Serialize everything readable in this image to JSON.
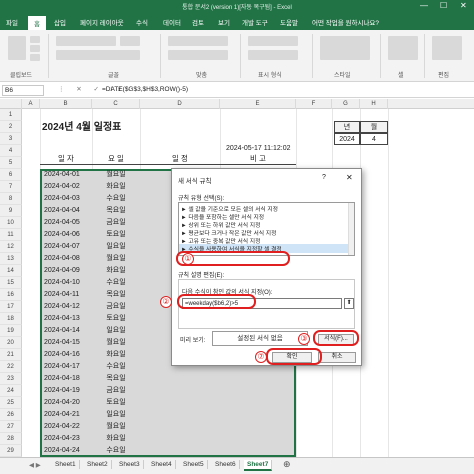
{
  "titlebar": {
    "title": "통합 문서2 (version 1)[자동 복구됨] - Excel",
    "min": "—",
    "max": "☐",
    "close": "✕"
  },
  "ribbon_tabs": [
    "파일",
    "홈",
    "삽입",
    "페이지 레이아웃",
    "수식",
    "데이터",
    "검토",
    "보기",
    "개발 도구",
    "도움말",
    "어떤 작업을 원하시나요?"
  ],
  "ribbon_groups": [
    "클립보드",
    "글꼴",
    "맞춤",
    "표시 형식",
    "스타일",
    "셀",
    "편집"
  ],
  "formula_bar": {
    "namebox": "B6",
    "icons": "⋮ ✕ ✓ fx",
    "formula": "=DATE($G$3,$H$3,ROW()-5)"
  },
  "columns": [
    "A",
    "B",
    "C",
    "D",
    "E",
    "F",
    "G",
    "H"
  ],
  "rows": [
    "1",
    "2",
    "3",
    "4",
    "5",
    "6",
    "7",
    "8",
    "9",
    "10",
    "11",
    "12",
    "13",
    "14",
    "15",
    "16",
    "17",
    "18",
    "19",
    "20",
    "21",
    "22",
    "23",
    "24",
    "25",
    "26",
    "27",
    "28",
    "29"
  ],
  "sheet": {
    "title": "2024년 4월 일정표",
    "timestamp": "2024-05-17 11:12:02",
    "header_year": "년",
    "header_month": "월",
    "year": "2024",
    "month": "4",
    "col_headers": {
      "date": "일 자",
      "weekday": "요 일",
      "schedule": "일 정",
      "note": "비 고"
    },
    "dates": [
      "2024-04-01",
      "2024-04-02",
      "2024-04-03",
      "2024-04-04",
      "2024-04-05",
      "2024-04-06",
      "2024-04-07",
      "2024-04-08",
      "2024-04-09",
      "2024-04-10",
      "2024-04-11",
      "2024-04-12",
      "2024-04-13",
      "2024-04-14",
      "2024-04-15",
      "2024-04-16",
      "2024-04-17",
      "2024-04-18",
      "2024-04-19",
      "2024-04-20",
      "2024-04-21",
      "2024-04-22",
      "2024-04-23",
      "2024-04-24"
    ],
    "weekdays": [
      "월요일",
      "화요일",
      "수요일",
      "목요일",
      "금요일",
      "토요일",
      "일요일",
      "월요일",
      "화요일",
      "수요일",
      "목요일",
      "금요일",
      "토요일",
      "일요일",
      "월요일",
      "화요일",
      "수요일",
      "목요일",
      "금요일",
      "토요일",
      "일요일",
      "월요일",
      "화요일",
      "수요일"
    ]
  },
  "sheet_tabs": [
    "Sheet1",
    "Sheet2",
    "Sheet3",
    "Sheet4",
    "Sheet5",
    "Sheet6",
    "Sheet7"
  ],
  "active_sheet": "Sheet7",
  "dialog": {
    "title": "새 서식 규칙",
    "help": "?",
    "close": "✕",
    "rule_type_label": "규칙 유형 선택(S):",
    "rule_types": [
      "► 셀 값을 기준으로 모든 셀의 서식 지정",
      "► 다음을 포함하는 셀만 서식 지정",
      "► 상위 또는 하위 값만 서식 지정",
      "► 평균보다 크거나 작은 값만 서식 지정",
      "► 고유 또는 중복 값만 서식 지정",
      "► 수식을 사용하여 서식을 지정할 셀 결정"
    ],
    "edit_label": "규칙 설명 편집(E):",
    "formula_label": "다음 수식이 참인 값의 서식 지정(O):",
    "formula_value": "=weekday($b6,2)>5",
    "formula_button": "⬆",
    "preview_label": "미리 보기:",
    "preview_text": "설정된 서식 없음",
    "format_button": "서식(F)...",
    "ok_button": "확인",
    "cancel_button": "취소"
  },
  "annotations": [
    "①",
    "②",
    "③",
    "⑦"
  ],
  "colors": {
    "excel_green": "#217346",
    "annotation_red": "#e02020",
    "selection_blue": "#cfe4f7"
  }
}
